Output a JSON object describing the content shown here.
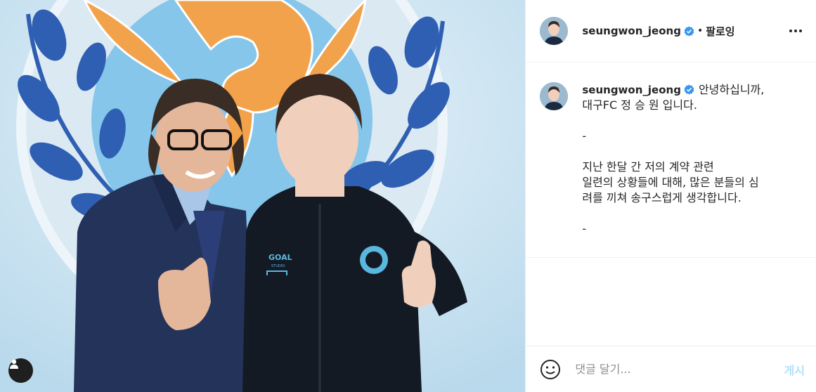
{
  "post": {
    "username": "seungwon_jeong",
    "follow_separator": "•",
    "follow_label": "팔로잉",
    "caption": "안녕하십니까,\n대구FC 정 승 원 입니다.\n\n-\n\n지난 한달 간 저의 계약 관련\n일련의 상황들에 대해, 많은 분들의 심\n려를 끼쳐 송구스럽게 생각합니다.\n\n-"
  },
  "comment_box": {
    "placeholder": "댓글 달기...",
    "post_label": "게시"
  },
  "photo": {
    "jacket_text": "GOAL",
    "jacket_subtext": "STUDIO"
  },
  "colors": {
    "verified_blue": "#3897f0",
    "post_button_disabled": "#b2dffc",
    "divider": "#efefef"
  },
  "icons": [
    "user-tag-icon",
    "verified-badge-icon",
    "more-options-icon",
    "emoji-icon"
  ]
}
